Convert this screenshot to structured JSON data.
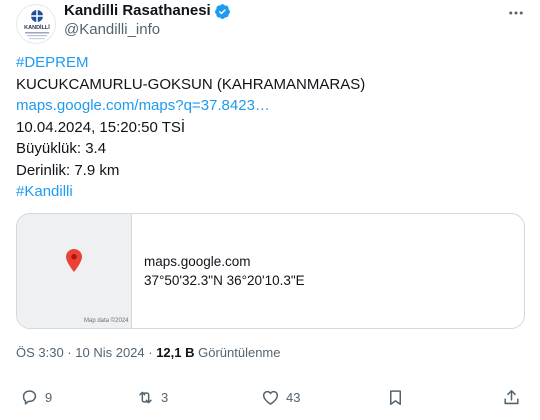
{
  "author": {
    "name": "Kandilli Rasathanesi",
    "handle": "@Kandilli_info",
    "avatar_text": "KANDİLLİ"
  },
  "tweet": {
    "hashtag1": "#DEPREM",
    "location": "KUCUKCAMURLU-GOKSUN (KAHRAMANMARAS)",
    "map_link": "maps.google.com/maps?q=37.8423…",
    "datetime": "10.04.2024, 15:20:50 TSİ",
    "magnitude": "Büyüklük: 3.4",
    "depth": "Derinlik: 7.9 km",
    "hashtag2": "#Kandilli"
  },
  "card": {
    "domain": "maps.google.com",
    "coords": "37°50'32.3\"N 36°20'10.3\"E",
    "map_attribution": "Map data ©2024"
  },
  "meta": {
    "timestamp": "ÖS 3:30 · 10 Nis 2024 · ",
    "views_count": "12,1 B",
    "views_label": " Görüntülenme"
  },
  "actions": {
    "reply_count": "9",
    "retweet_count": "3",
    "like_count": "43"
  },
  "colors": {
    "link": "#1d9bf0",
    "text": "#0f1419",
    "muted": "#536471",
    "pin": "#ea4335"
  }
}
